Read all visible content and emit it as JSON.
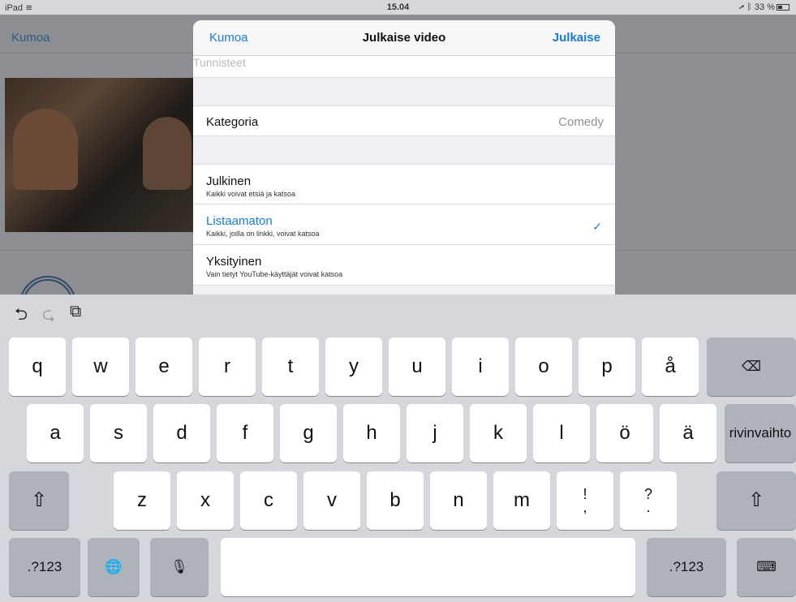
{
  "status": {
    "device": "iPad",
    "time": "15.04",
    "battery": "33 %"
  },
  "background": {
    "cancel_label": "Kumoa"
  },
  "modal": {
    "cancel_label": "Kumoa",
    "title": "Julkaise video",
    "publish_label": "Julkaise",
    "tags_placeholder": "Tunnisteet",
    "category_label": "Kategoria",
    "category_value": "Comedy",
    "privacy_options": [
      {
        "title": "Julkinen",
        "subtitle": "Kaikki voivat etsiä ja katsoa"
      },
      {
        "title": "Listaamaton",
        "subtitle": "Kaikki, joilla on linkki, voivat katsoa",
        "selected": true
      },
      {
        "title": "Yksityinen",
        "subtitle": "Vain tietyt YouTube-käyttäjät voivat katsoa"
      }
    ],
    "check_mark": "✓"
  },
  "keyboard": {
    "tools": {
      "undo": "⮌",
      "redo": "⮎",
      "paste": "⧉"
    },
    "row1": [
      "q",
      "w",
      "e",
      "r",
      "t",
      "y",
      "u",
      "i",
      "o",
      "p",
      "å"
    ],
    "row2": [
      "a",
      "s",
      "d",
      "f",
      "g",
      "h",
      "j",
      "k",
      "l",
      "ö",
      "ä"
    ],
    "row3": [
      "z",
      "x",
      "c",
      "v",
      "b",
      "n",
      "m"
    ],
    "row3_punct": [
      {
        "top": "!",
        "bottom": ","
      },
      {
        "top": "?",
        "bottom": "."
      }
    ],
    "backspace": "⌫",
    "return_label": "rivinvaihto",
    "shift": "⇧",
    "numbers_label": ".?123",
    "globe": "🌐",
    "mic": "🎙",
    "hide_keyboard": "⌨"
  },
  "colors": {
    "accent": "#1a7ad8"
  }
}
